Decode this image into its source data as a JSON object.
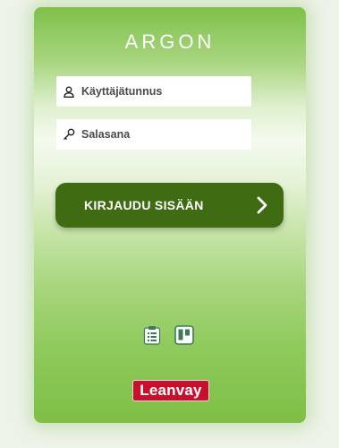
{
  "app": {
    "title": "ARGON"
  },
  "login": {
    "username_placeholder": "Käyttäjätunnus",
    "password_placeholder": "Salasana",
    "submit_label": "KIRJAUDU SISÄÄN"
  },
  "footer": {
    "brand_label": "Leanvay"
  },
  "icons": {
    "username": "user-icon",
    "password": "key-icon",
    "submit": "chevron-right-icon",
    "app1": "clipboard-icon",
    "app2": "board-icon"
  },
  "colors": {
    "accent_dark": "#3f6b13",
    "card_green": "#7ebf47",
    "brand_red": "#c8102e"
  }
}
